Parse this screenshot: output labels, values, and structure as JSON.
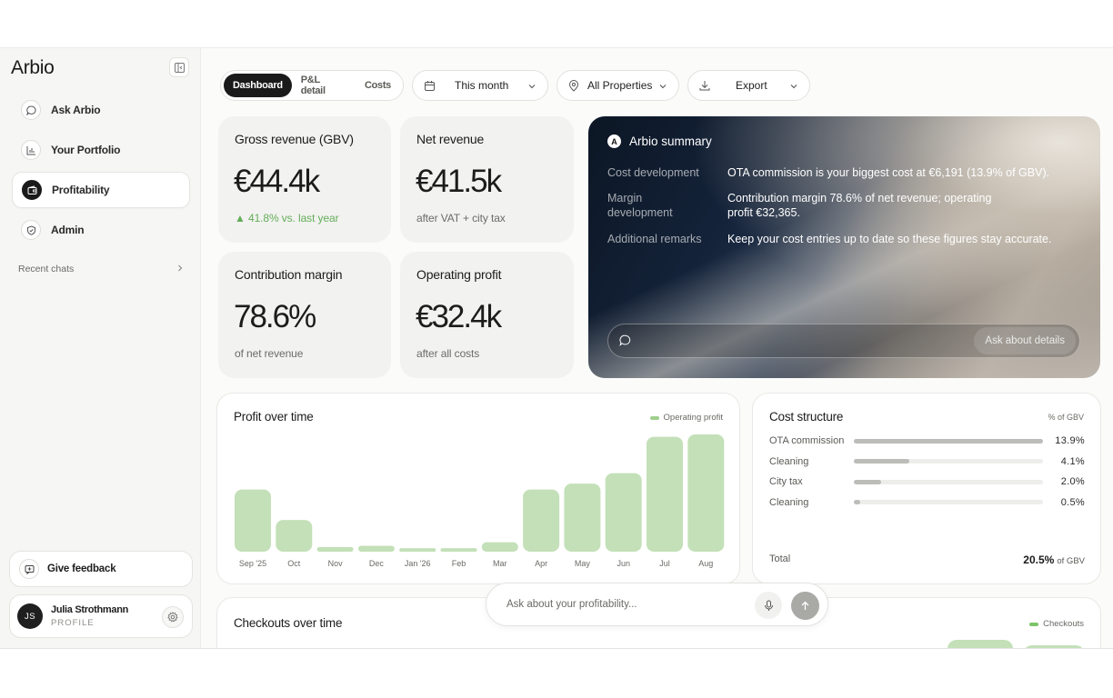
{
  "sidebar": {
    "logo": "Arbio",
    "nav": [
      {
        "label": "Ask Arbio",
        "icon": "chat-bubble-icon"
      },
      {
        "label": "Your Portfolio",
        "icon": "bar-chart-icon"
      },
      {
        "label": "Profitability",
        "icon": "wallet-icon",
        "active": true
      },
      {
        "label": "Admin",
        "icon": "shield-icon"
      }
    ],
    "recent_chats": "Recent chats",
    "feedback": "Give feedback",
    "profile": {
      "initials": "JS",
      "name": "Julia Strothmann",
      "role": "PROFILE"
    }
  },
  "toolbar": {
    "tabs": [
      "Dashboard",
      "P&L detail",
      "Costs"
    ],
    "active_tab": "Dashboard",
    "period": "This month",
    "properties": "All Properties",
    "export": "Export"
  },
  "kpis": {
    "gross": {
      "label": "Gross revenue (GBV)",
      "value": "€44.4k",
      "sub": "▲ 41.8% vs. last year"
    },
    "net": {
      "label": "Net revenue",
      "value": "€41.5k",
      "sub": "after VAT + city tax"
    },
    "margin": {
      "label": "Contribution margin",
      "value": "78.6%",
      "sub": "of net revenue"
    },
    "profit": {
      "label": "Operating profit",
      "value": "€32.4k",
      "sub": "after all costs"
    }
  },
  "summary": {
    "title": "Arbio summary",
    "logo_letter": "A",
    "rows": [
      {
        "key": "Cost development",
        "value": "OTA commission is your biggest cost at €6,191 (13.9% of GBV)."
      },
      {
        "key": "Margin development",
        "value": "Contribution margin 78.6% of net revenue; operating profit €32,365."
      },
      {
        "key": "Additional remarks",
        "value": "Keep your cost entries up to date so these figures stay accurate."
      }
    ],
    "ask_button": "Ask about details"
  },
  "profit_chart": {
    "title": "Profit over time",
    "legend": "Operating profit"
  },
  "cost_structure": {
    "title": "Cost structure",
    "unit": "% of GBV",
    "items": [
      {
        "name": "OTA commission",
        "pct": "13.9%",
        "value": 13.9
      },
      {
        "name": "Cleaning",
        "pct": "4.1%",
        "value": 4.1
      },
      {
        "name": "City tax",
        "pct": "2.0%",
        "value": 2.0
      },
      {
        "name": "Cleaning",
        "pct": "0.5%",
        "value": 0.5
      }
    ],
    "total_label": "Total",
    "total_value": "20.5%",
    "total_unit": "of GBV"
  },
  "checkouts_chart": {
    "title": "Checkouts over time",
    "legend": "Checkouts"
  },
  "chat": {
    "placeholder": "Ask about your profitability..."
  },
  "colors": {
    "accent_green": "#9fcf8e",
    "bar_green": "#c3e0b8",
    "dark": "#1a1a1a"
  },
  "chart_data": {
    "type": "bar",
    "categories": [
      "Sep '25",
      "Oct",
      "Nov",
      "Dec",
      "Jan '26",
      "Feb",
      "Mar",
      "Apr",
      "May",
      "Jun",
      "Jul",
      "Aug"
    ],
    "series": [
      {
        "name": "Operating profit",
        "values": [
          53,
          27,
          4,
          5,
          3,
          3,
          8,
          53,
          58,
          67,
          98,
          100
        ]
      }
    ],
    "title": "Profit over time",
    "ylim": [
      0,
      100
    ],
    "grid": false,
    "legend": "top-right"
  }
}
